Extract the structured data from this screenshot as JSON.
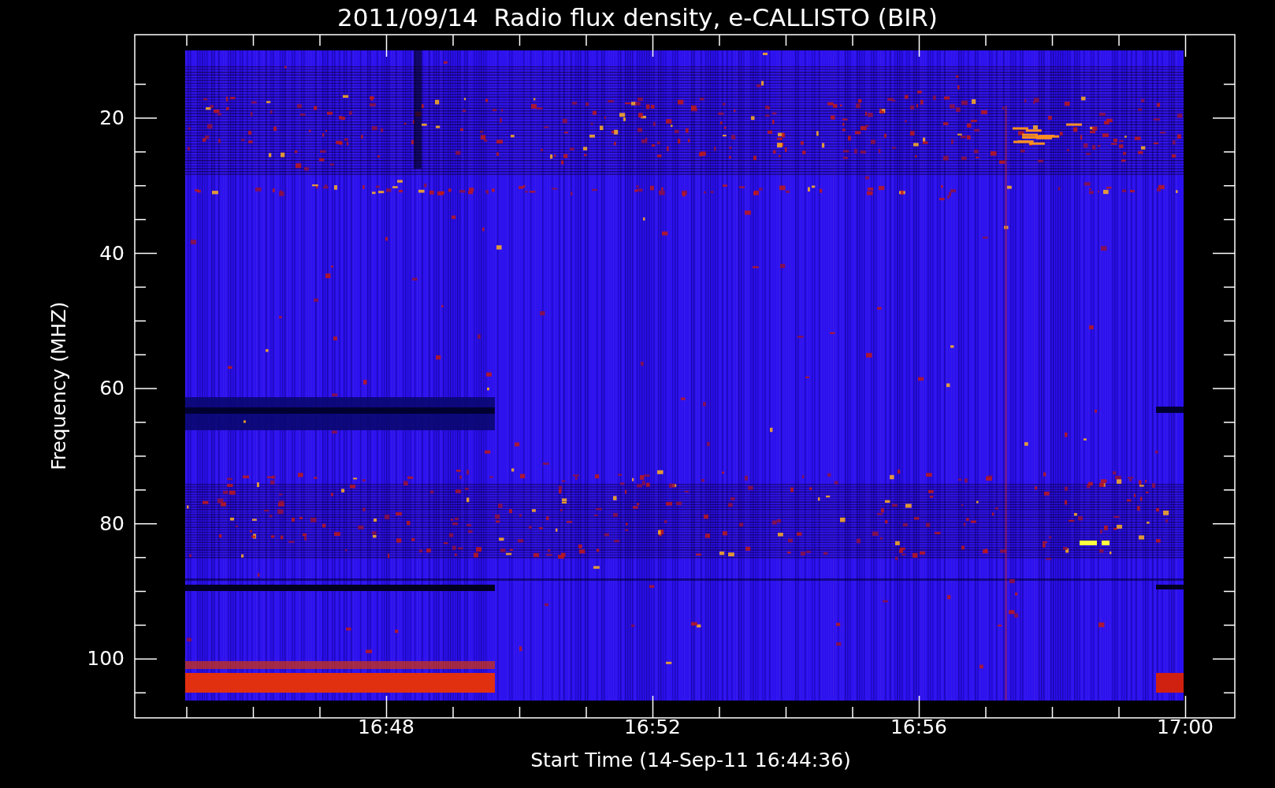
{
  "title": "2011/09/14  Radio flux density, e-CALLISTO (BIR)",
  "y_axis": {
    "label": "Frequency (MHZ)",
    "tick_labels": [
      "20",
      "40",
      "60",
      "80",
      "100"
    ]
  },
  "x_axis": {
    "label": "Start Time (14-Sep-11 16:44:36)",
    "tick_labels": [
      "16:48",
      "16:52",
      "16:56",
      "17:00"
    ]
  }
}
